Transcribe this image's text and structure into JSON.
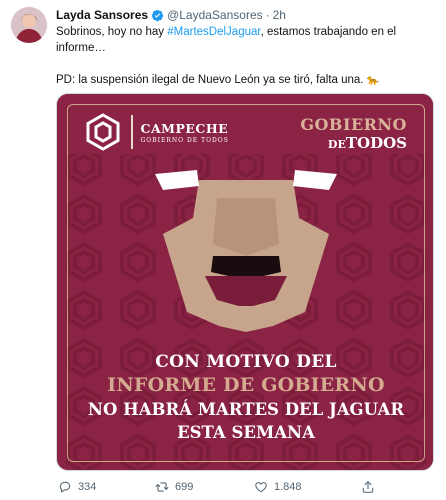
{
  "tweet": {
    "author_name": "Layda Sansores",
    "handle": "@LaydaSansores",
    "separator": "·",
    "time": "2h",
    "text_before_hashtag": "Sobrinos, hoy no hay ",
    "hashtag": "#MartesDelJaguar",
    "text_after_hashtag": ", estamos trabajando en el informe…",
    "text_second": "PD: la suspensión ilegal de Nuevo León ya se tiró, falta una. ",
    "emoji": "🐆"
  },
  "image": {
    "brand_title": "CAMPECHE",
    "brand_subtitle": "GOBIERNO DE TODOS",
    "gob_line1": "GOBIERNO",
    "gob_line2_small": "DE",
    "gob_line2": "TODOS",
    "line1": "CON MOTIVO DEL",
    "line2": "INFORME DE GOBIERNO",
    "line3": "NO HABRÁ MARTES DEL JAGUAR",
    "line4": "ESTA SEMANA",
    "colors": {
      "background": "#8b2444",
      "pattern": "#7a1d3a",
      "accent": "#cda48a",
      "face": "#c6a58c"
    }
  },
  "actions": {
    "replies": "334",
    "retweets": "699",
    "likes": "1.848"
  }
}
